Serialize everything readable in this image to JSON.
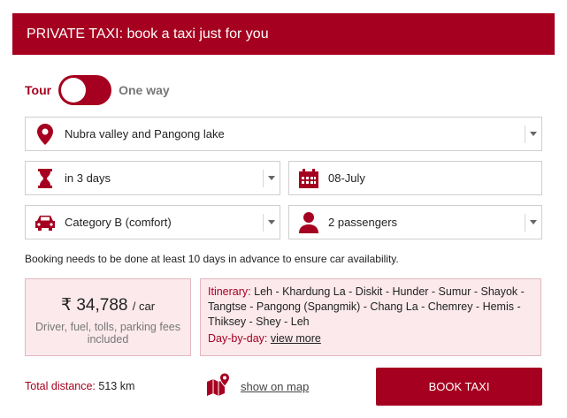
{
  "header": {
    "title": "PRIVATE TAXI: book a taxi just for you"
  },
  "mode": {
    "left_label": "Tour",
    "right_label": "One way"
  },
  "fields": {
    "route": {
      "value": "Nubra valley and Pangong lake",
      "icon": "map-pin-icon"
    },
    "duration": {
      "value": "in 3 days",
      "icon": "hourglass-icon"
    },
    "date": {
      "value": "08-July",
      "icon": "calendar-icon"
    },
    "category": {
      "value": "Category B (comfort)",
      "icon": "car-icon"
    },
    "passengers": {
      "value": "2 passengers",
      "icon": "person-icon"
    }
  },
  "note": "Booking needs to be done at least 10 days in advance to ensure car availability.",
  "price": {
    "amount": "₹ 34,788",
    "per": "/ car",
    "includes": "Driver, fuel, tolls, parking fees included"
  },
  "itinerary": {
    "label": "Itinerary:",
    "route": "Leh - Khardung La - Diskit - Hunder - Sumur - Shayok - Tangtse - Pangong (Spangmik) - Chang La - Chemrey - Hemis - Thiksey - Shey - Leh",
    "daybyday_label": "Day-by-day:",
    "view_more": "view more"
  },
  "footer": {
    "total_label": "Total distance:",
    "total_value": "513 km",
    "show_on_map": "show on map",
    "book_button": "BOOK TAXI"
  },
  "colors": {
    "brand": "#a5001f",
    "panel_bg": "#fbe9ec"
  }
}
